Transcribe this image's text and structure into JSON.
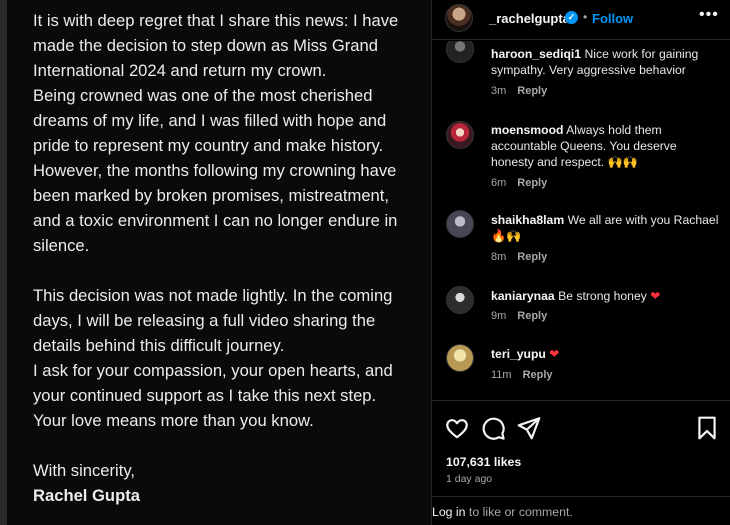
{
  "post": {
    "paragraphs": [
      "It is with deep regret that I share this news: I have made the decision to step down as Miss Grand International 2024 and return my crown.",
      "Being crowned was one of the most cherished dreams of my life, and I was filled with hope and pride to represent my country and make history.",
      "However, the months following my crowning have been marked by broken promises, mistreatment, and a toxic environment I can no longer endure in silence.",
      "This decision was not made lightly. In the coming days, I will be releasing a full video sharing the details behind this difficult journey.",
      "I ask for your compassion, your open hearts, and your continued support as I take this next step.",
      "Your love means more than you know.",
      "With sincerity,",
      "Rachel Gupta"
    ]
  },
  "header": {
    "username": "_rachelgupta",
    "verified_mark": "✓",
    "separator": "•",
    "follow_label": "Follow",
    "more_label": "•••"
  },
  "comments": [
    {
      "user": "haroon_sediqi1",
      "text": "Nice work for gaining sympathy. Very aggressive behavior",
      "time": "3m",
      "reply": "Reply"
    },
    {
      "user": "moensmood",
      "text": "Always hold them accountable Queens. You deserve honesty and respect. 🙌🙌",
      "time": "6m",
      "reply": "Reply"
    },
    {
      "user": "shaikha8lam",
      "text": "We all are with you Rachael 🔥🙌",
      "time": "8m",
      "reply": "Reply"
    },
    {
      "user": "kaniarynaa",
      "text": "Be strong honey",
      "time": "9m",
      "reply": "Reply",
      "heart": "❤"
    },
    {
      "user": "teri_yupu",
      "text": "",
      "time": "11m",
      "reply": "Reply",
      "heart": "❤"
    }
  ],
  "icons": {
    "like": "heart-outline-icon",
    "comment": "comment-bubble-icon",
    "share": "paper-plane-icon",
    "save": "bookmark-icon"
  },
  "stats": {
    "likes": "107,631 likes",
    "time_ago": "1 day ago"
  },
  "login_bar": {
    "link": "Log in",
    "rest": " to like or comment."
  },
  "colors": {
    "accent": "#0095f6",
    "heart": "#ff3040",
    "background": "#000000",
    "muted": "#a8a8a8"
  }
}
